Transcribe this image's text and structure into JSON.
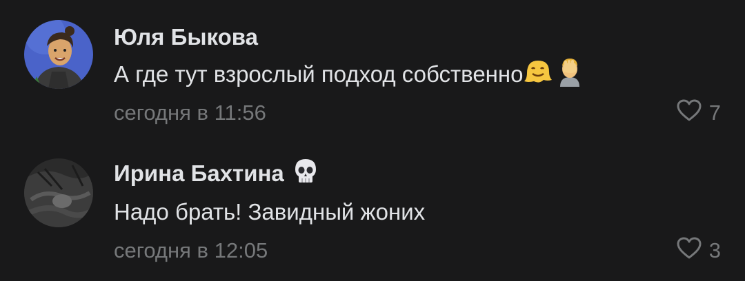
{
  "comments": [
    {
      "author": "Юля Быкова",
      "text": "А где тут взрослый подход собственно",
      "text_emojis": [
        "melting-face-emoji",
        "facepalm-emoji"
      ],
      "time": "сегодня в 11:56",
      "likes": "7",
      "avatar": "illustrated-portrait-avatar"
    },
    {
      "author": "Ирина Бахтина",
      "author_badge": "skull-emoji",
      "text": "Надо брать! Завидный жоних",
      "time": "сегодня в 12:05",
      "likes": "3",
      "avatar": "dark-photo-avatar"
    }
  ],
  "colors": {
    "background": "#19191a",
    "primary_text": "#e1e3e6",
    "secondary_text": "#76787a"
  }
}
